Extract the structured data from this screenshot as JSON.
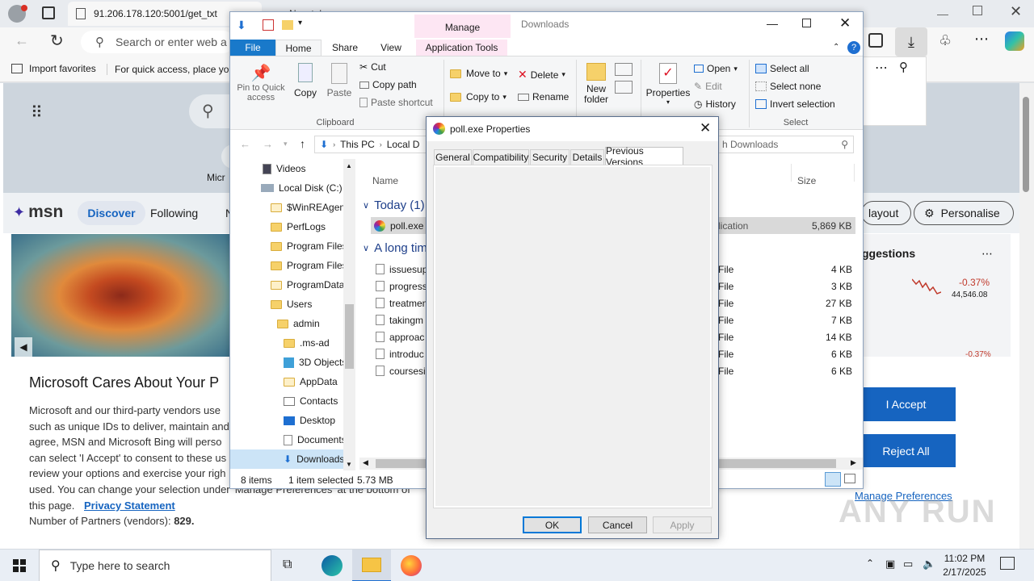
{
  "browser": {
    "tab_title": "91.206.178.120:5001/get_txt",
    "tab2_title": "New tab",
    "address_placeholder": "Search or enter web a",
    "favorites": {
      "import": "Import favorites",
      "hint": "For quick access, place yo"
    }
  },
  "msn": {
    "brand": "msn",
    "nav": {
      "discover": "Discover",
      "following": "Following",
      "more": "N"
    },
    "top_link": "Micr",
    "layout_btn": "layout",
    "personalise_btn": "Personalise",
    "suggestions_title": "ggestions",
    "stock": {
      "change": "-0.37%",
      "value": "44,546.08",
      "change2": "-0.37%"
    }
  },
  "consent": {
    "title": "Microsoft Cares About Your P",
    "lines": [
      "Microsoft and our third-party vendors use",
      "such as unique IDs to deliver, maintain and",
      "agree, MSN and Microsoft Bing will perso",
      "can select 'I Accept' to consent to these us",
      "review your options and exercise your righ",
      "used.  You can change your selection under 'Manage Preferences' at the bottom of",
      "this page."
    ],
    "privacy_link": "Privacy Statement",
    "partners_label": "Number of Partners (vendors):",
    "partners_count": "829.",
    "accept": "I Accept",
    "reject": "Reject All",
    "manage": "Manage Preferences"
  },
  "explorer": {
    "title": "Downloads",
    "manage_tab": "Manage",
    "tabs": [
      "File",
      "Home",
      "Share",
      "View",
      "Application Tools"
    ],
    "clipboard": {
      "pin": "Pin to Quick access",
      "copy": "Copy",
      "paste": "Paste",
      "cut": "Cut",
      "copy_path": "Copy path",
      "paste_shortcut": "Paste shortcut",
      "label": "Clipboard"
    },
    "organize": {
      "move_to": "Move to",
      "copy_to": "Copy to",
      "delete": "Delete",
      "rename": "Rename"
    },
    "new": {
      "new_folder": "New folder"
    },
    "open": {
      "properties": "Properties",
      "open": "Open",
      "edit": "Edit",
      "history": "History"
    },
    "select": {
      "all": "Select all",
      "none": "Select none",
      "invert": "Invert selection",
      "label": "Select"
    },
    "breadcrumb": [
      "This PC",
      "Local D"
    ],
    "search_placeholder": "h Downloads",
    "nav_items": [
      "Videos",
      "Local Disk (C:)",
      "$WinREAgent",
      "PerfLogs",
      "Program Files",
      "Program Files",
      "ProgramData",
      "Users",
      "admin",
      ".ms-ad",
      "3D Objects",
      "AppData",
      "Contacts",
      "Desktop",
      "Documents",
      "Downloads"
    ],
    "columns": {
      "name": "Name",
      "size": "Size"
    },
    "groups": {
      "today": "Today (1)",
      "longtime": "A long tim"
    },
    "files_today": [
      {
        "name": "poll.exe",
        "type": "lication",
        "size": "5,869 KB"
      }
    ],
    "files_old": [
      {
        "name": "issuesup",
        "type": "File",
        "size": "4 KB"
      },
      {
        "name": "progress",
        "type": "File",
        "size": "3 KB"
      },
      {
        "name": "treatmen",
        "type": "File",
        "size": "27 KB"
      },
      {
        "name": "takingm",
        "type": "File",
        "size": "7 KB"
      },
      {
        "name": "approac",
        "type": "File",
        "size": "14 KB"
      },
      {
        "name": "introduc",
        "type": "File",
        "size": "6 KB"
      },
      {
        "name": "coursesi",
        "type": "File",
        "size": "6 KB"
      }
    ],
    "status": {
      "items": "8 items",
      "selected": "1 item selected",
      "size": "5.73 MB"
    }
  },
  "props": {
    "title": "poll.exe Properties",
    "tabs": [
      "General",
      "Compatibility",
      "Security",
      "Details",
      "Previous Versions"
    ],
    "ok": "OK",
    "cancel": "Cancel",
    "apply": "Apply"
  },
  "taskbar": {
    "search_placeholder": "Type here to search",
    "time": "11:02 PM",
    "date": "2/17/2025"
  },
  "watermark": "ANY RUN"
}
